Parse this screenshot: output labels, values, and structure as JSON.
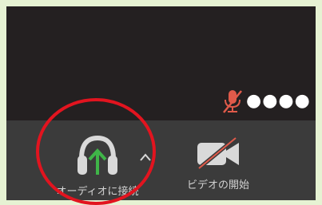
{
  "participant": {
    "name": "●●●●",
    "mic_status": "muted"
  },
  "toolbar": {
    "audio_label": "オーディオに接続",
    "video_label": "ビデオの開始"
  },
  "icons": {
    "mic": "mic-muted-icon",
    "headphone": "headphone-icon",
    "arrow": "arrow-up-icon",
    "caret": "caret-up-icon",
    "camera": "camera-off-icon"
  },
  "colors": {
    "background": "#e6f2d3",
    "video_area": "#242021",
    "toolbar": "#3b3b3b",
    "muted_red": "#e05a4a",
    "arrow_green": "#3fb548",
    "highlight_red": "#e2141f"
  }
}
